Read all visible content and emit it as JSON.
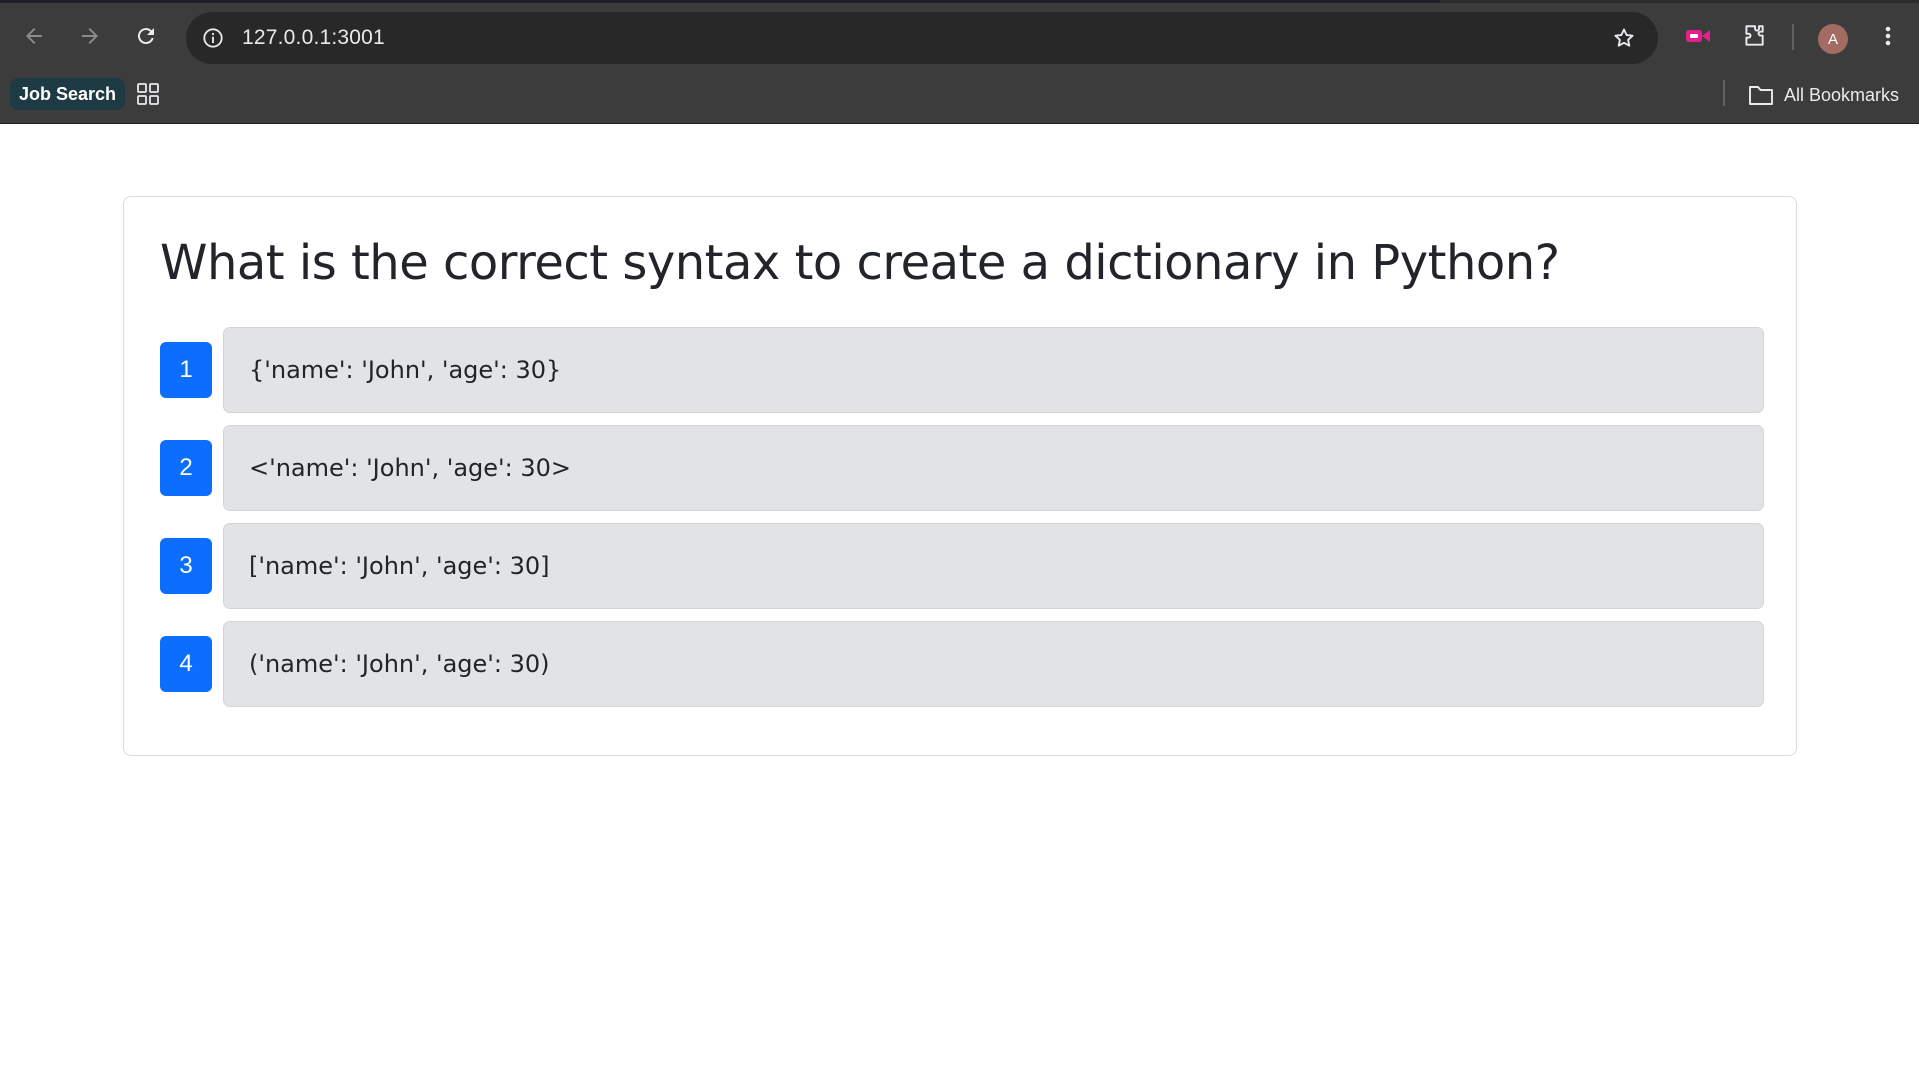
{
  "browser": {
    "url": "127.0.0.1:3001",
    "bookmarks": [
      {
        "label": "Job Search"
      }
    ],
    "all_bookmarks_label": "All Bookmarks",
    "avatar_letter": "A",
    "icons": [
      "back-icon",
      "forward-icon",
      "reload-icon",
      "site-info-icon",
      "star-icon",
      "extension-puzzle-icon",
      "menu-dots-icon",
      "apps-grid-icon",
      "folder-icon"
    ]
  },
  "quiz": {
    "question": "What is the correct syntax to create a dictionary in Python?",
    "options": [
      {
        "number": "1",
        "text": "{'name': 'John', 'age': 30}"
      },
      {
        "number": "2",
        "text": "<'name': 'John', 'age': 30>"
      },
      {
        "number": "3",
        "text": "['name': 'John', 'age': 30]"
      },
      {
        "number": "4",
        "text": "('name': 'John', 'age': 30)"
      }
    ]
  },
  "colors": {
    "accent": "#0d6efd",
    "option_bg": "#e2e3e5",
    "chrome_bg": "#3c3c3c"
  }
}
